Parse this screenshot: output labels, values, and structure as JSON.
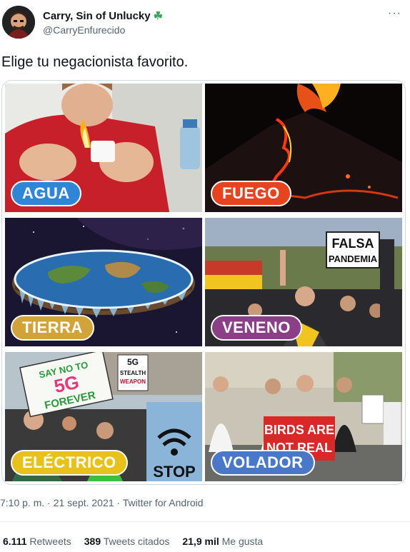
{
  "author": {
    "name": "Carry, Sin of Unlucky",
    "emoji": "☘",
    "handle": "@CarryEnfurecido"
  },
  "more_icon": "···",
  "tweet_text": "Elige tu negacionista favorito.",
  "tiles": [
    {
      "label": "AGUA",
      "color": "#2f86d6"
    },
    {
      "label": "FUEGO",
      "color": "#e8431f"
    },
    {
      "label": "TIERRA",
      "color": "#d2a338"
    },
    {
      "label": "VENENO",
      "color": "#8a3f87"
    },
    {
      "label": "ELÉCTRICO",
      "color": "#e8c21a"
    },
    {
      "label": "VOLADOR",
      "color": "#4a78c8"
    }
  ],
  "signs": {
    "falsa_line1": "FALSA",
    "falsa_line2": "PANDEMIA",
    "say_no_line1": "SAY NO TO",
    "say_no_line2": "5G",
    "say_no_line3": "FOREVER",
    "stealth_line1": "5G",
    "stealth_line2": "STEALTH",
    "stealth_line3": "WEAPON",
    "birds_line1": "BIRDS ARE",
    "birds_line2": "NOT REAL",
    "stop": "STOP"
  },
  "meta": {
    "time": "7:10 p. m. · 21 sept. 2021 · Twitter for Android"
  },
  "stats": {
    "retweets_count": "6.111",
    "retweets_label": "Retweets",
    "quotes_count": "389",
    "quotes_label": "Tweets citados",
    "likes_count": "21,9 mil",
    "likes_label": "Me gusta"
  }
}
